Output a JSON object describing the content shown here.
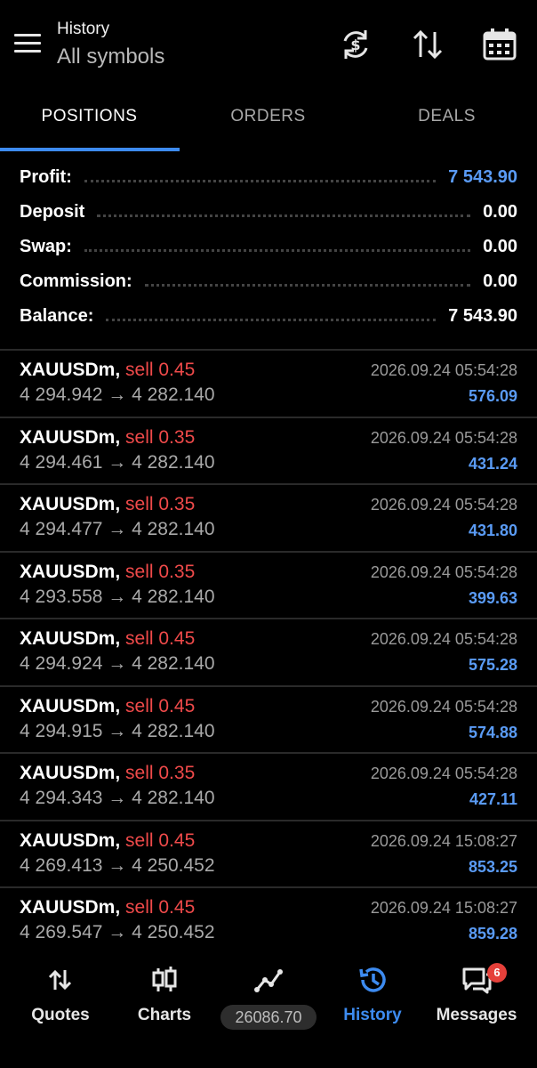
{
  "header": {
    "subtitle": "History",
    "title": "All symbols"
  },
  "tabs": [
    {
      "label": "POSITIONS"
    },
    {
      "label": "ORDERS"
    },
    {
      "label": "DEALS"
    }
  ],
  "summary": [
    {
      "label": "Profit:",
      "value": "7 543.90"
    },
    {
      "label": "Deposit",
      "value": "0.00"
    },
    {
      "label": "Swap:",
      "value": "0.00"
    },
    {
      "label": "Commission:",
      "value": "0.00"
    },
    {
      "label": "Balance:",
      "value": "7 543.90"
    }
  ],
  "deals": [
    {
      "symbol": "XAUUSDm,",
      "side": "sell 0.45",
      "prices": "4 294.942 → 4 282.140",
      "time": "2026.09.24 05:54:28",
      "profit": "576.09"
    },
    {
      "symbol": "XAUUSDm,",
      "side": "sell 0.35",
      "prices": "4 294.461 → 4 282.140",
      "time": "2026.09.24 05:54:28",
      "profit": "431.24"
    },
    {
      "symbol": "XAUUSDm,",
      "side": "sell 0.35",
      "prices": "4 294.477 → 4 282.140",
      "time": "2026.09.24 05:54:28",
      "profit": "431.80"
    },
    {
      "symbol": "XAUUSDm,",
      "side": "sell 0.35",
      "prices": "4 293.558 → 4 282.140",
      "time": "2026.09.24 05:54:28",
      "profit": "399.63"
    },
    {
      "symbol": "XAUUSDm,",
      "side": "sell 0.45",
      "prices": "4 294.924 → 4 282.140",
      "time": "2026.09.24 05:54:28",
      "profit": "575.28"
    },
    {
      "symbol": "XAUUSDm,",
      "side": "sell 0.45",
      "prices": "4 294.915 → 4 282.140",
      "time": "2026.09.24 05:54:28",
      "profit": "574.88"
    },
    {
      "symbol": "XAUUSDm,",
      "side": "sell 0.35",
      "prices": "4 294.343 → 4 282.140",
      "time": "2026.09.24 05:54:28",
      "profit": "427.11"
    },
    {
      "symbol": "XAUUSDm,",
      "side": "sell 0.45",
      "prices": "4 269.413 → 4 250.452",
      "time": "2026.09.24 15:08:27",
      "profit": "853.25"
    },
    {
      "symbol": "XAUUSDm,",
      "side": "sell 0.45",
      "prices": "4 269.547 → 4 250.452",
      "time": "2026.09.24 15:08:27",
      "profit": "859.28"
    }
  ],
  "nav": {
    "quotes": "Quotes",
    "charts": "Charts",
    "equity": "26086.70",
    "history": "History",
    "messages": "Messages",
    "messages_badge": "6"
  },
  "colors": {
    "accent": "#3d8bf0",
    "sell": "#ef4a4a",
    "profit": "#5a9bf5",
    "background": "#000000"
  },
  "icons": [
    "menu-icon",
    "currency-exchange-icon",
    "sort-icon",
    "calendar-icon",
    "quotes-icon",
    "charts-icon",
    "trade-icon",
    "history-icon",
    "messages-icon"
  ]
}
